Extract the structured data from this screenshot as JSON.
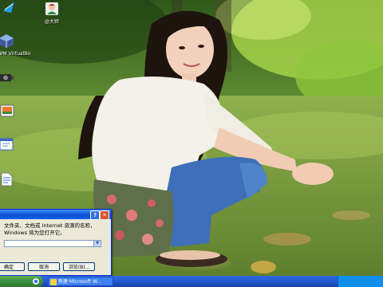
{
  "desktop": {
    "icons": [
      {
        "name": "",
        "icon": "recycle-bin-icon"
      },
      {
        "name": "@大师",
        "icon": "person-icon"
      },
      {
        "name": "Oracle VM VirtualBox",
        "icon": "virtualbox-icon"
      },
      {
        "name": "",
        "icon": "camera-icon"
      },
      {
        "name": "",
        "icon": "image-icon"
      },
      {
        "name": "",
        "icon": "window-icon"
      },
      {
        "name": "",
        "icon": "document-icon"
      }
    ]
  },
  "run_dialog": {
    "prompt": "文件夹、文档或 Internet 资源的名称，Windows 将为您打开它。",
    "input_value": "",
    "ok_label": "确定",
    "cancel_label": "取消",
    "browse_label": "浏览(B)...",
    "help_glyph": "?",
    "close_glyph": "✕"
  },
  "taskbar": {
    "task_label": "新建 Microsoft W..."
  },
  "colors": {
    "titlebar": "#0a4fd4",
    "taskbar": "#245edb",
    "start": "#3c8f3c"
  }
}
